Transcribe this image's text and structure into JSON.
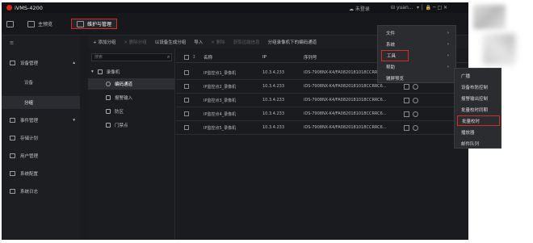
{
  "app": {
    "title": "iVMS-4200"
  },
  "titlebar": {
    "status": "未登录",
    "user": "yuan...",
    "controls": [
      "▾",
      "│",
      "🔒",
      "─",
      "□",
      "✕"
    ]
  },
  "tabs": [
    {
      "label": "主预览",
      "active": false
    },
    {
      "label": "维护与管理",
      "active": true
    }
  ],
  "toolbar": {
    "items": [
      {
        "label": "+ 添加分组",
        "enabled": true
      },
      {
        "label": "✕ 删除分组",
        "enabled": false
      },
      {
        "label": "以设备生成分组",
        "enabled": true
      },
      {
        "label": "导入",
        "enabled": true
      },
      {
        "label": "✕ 删除",
        "enabled": false
      },
      {
        "label": "获取远端信息",
        "enabled": false
      },
      {
        "label": "分组录像机下的编码通道",
        "enabled": true
      }
    ]
  },
  "sidebar": {
    "items": [
      {
        "label": "设备管理",
        "expanded": true,
        "icon": "device-icon"
      },
      {
        "label": "设备",
        "sub": true,
        "active": false
      },
      {
        "label": "分组",
        "sub": true,
        "active": true
      },
      {
        "label": "事件管理",
        "icon": "event-icon"
      },
      {
        "label": "存储计划",
        "icon": "storage-icon"
      },
      {
        "label": "用户管理",
        "icon": "user-icon"
      },
      {
        "label": "系统配置",
        "icon": "gear-icon"
      },
      {
        "label": "系统日志",
        "icon": "log-icon"
      }
    ]
  },
  "tree": {
    "search_placeholder": "搜索",
    "root": "录像机",
    "items": [
      "编码通道",
      "报警输入",
      "防区",
      "门禁点"
    ]
  },
  "grid": {
    "columns": [
      "名称",
      "IP",
      "序列号"
    ],
    "rows": [
      {
        "name": "IP监控点1_录像机",
        "ip": "10.3.4.233",
        "serial": "iDS-7908NX-K4/FA0820181018CCRRC6..."
      },
      {
        "name": "IP监控点2_录像机",
        "ip": "10.3.4.233",
        "serial": "iDS-7908NX-K4/FA0820181018CCRRC6..."
      },
      {
        "name": "IP监控点3_录像机",
        "ip": "10.3.4.233",
        "serial": "iDS-7908NX-K4/FA0820181018CCRRC6..."
      },
      {
        "name": "IP监控点4_录像机",
        "ip": "10.3.4.233",
        "serial": "iDS-7908NX-K4/FA0820181018CCRRC6..."
      },
      {
        "name": "IP监控点5_录像机",
        "ip": "10.3.4.233",
        "serial": "iDS-7908NX-K4/FA0820181018CCRRC6..."
      }
    ]
  },
  "menu": {
    "items": [
      {
        "label": "文件",
        "submenu": true,
        "highlight": false
      },
      {
        "label": "系统",
        "submenu": true,
        "highlight": false
      },
      {
        "label": "工具",
        "submenu": true,
        "highlight": true
      },
      {
        "label": "帮助",
        "submenu": true,
        "highlight": false
      },
      {
        "label": "辅屏预览",
        "submenu": false,
        "highlight": false
      }
    ]
  },
  "submenu": {
    "items": [
      {
        "label": "广播",
        "highlight": false
      },
      {
        "label": "设备布防控制",
        "highlight": false
      },
      {
        "label": "报警输出控制",
        "highlight": false
      },
      {
        "label": "批量校时同期",
        "highlight": false
      },
      {
        "label": "批量校时",
        "highlight": true
      },
      {
        "label": "播放器",
        "highlight": false
      },
      {
        "label": "邮件队列",
        "highlight": false
      }
    ]
  },
  "colors": {
    "accent_red": "#d32a2a",
    "bg_dark": "#1a1b1f",
    "logo_red": "#e2231a"
  }
}
